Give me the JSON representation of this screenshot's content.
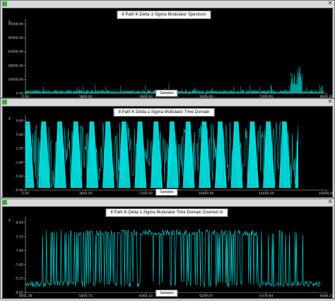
{
  "windows": [
    {
      "title": "8 Path K-Delta-1-Sigma Modulator Spectrum",
      "y_axis_label": "y",
      "x_axis_button": "Samples",
      "y_ticks": [
        "70000.00",
        "56000.00",
        "42000.00",
        "28000.00",
        "14000.00",
        "0.00"
      ],
      "x_ticks": [
        "0.00",
        "1800.00",
        "3600.00",
        "5400.00",
        "7200.00",
        "9000.00"
      ]
    },
    {
      "title": "8 Path K-Delta-1-Sigma Modulator Time Domain",
      "y_axis_label": "y",
      "x_axis_button": "Samples",
      "y_ticks": [
        "9.60",
        "5.80",
        "2.00",
        "-1.80",
        "-5.60",
        "-9.40"
      ],
      "x_ticks": [
        "0.00",
        "3600.00",
        "7200.00",
        "10800.00",
        "14400.00",
        "18000.00"
      ]
    },
    {
      "title": "8 Path K-Delta-1-Sigma Modulator Time Domain Zoomed In",
      "y_axis_label": "y",
      "x_axis_button": "Samples",
      "y_ticks": [
        "8.83",
        "5.33",
        "1.84",
        "-1.66",
        "-5.15",
        "-8.65"
      ],
      "x_ticks": [
        "5841.36",
        "5850.73",
        "6060.10",
        "6269.47",
        "6478.84",
        "6688.21"
      ]
    }
  ],
  "colors": {
    "plot_bg": "#000000",
    "trace": "#00e5e5",
    "grid_text": "#d0d0d0",
    "axis": "#c8c8c8"
  },
  "icons": {
    "app": "app-icon",
    "close": "close-icon"
  },
  "close_glyph": "✕"
}
